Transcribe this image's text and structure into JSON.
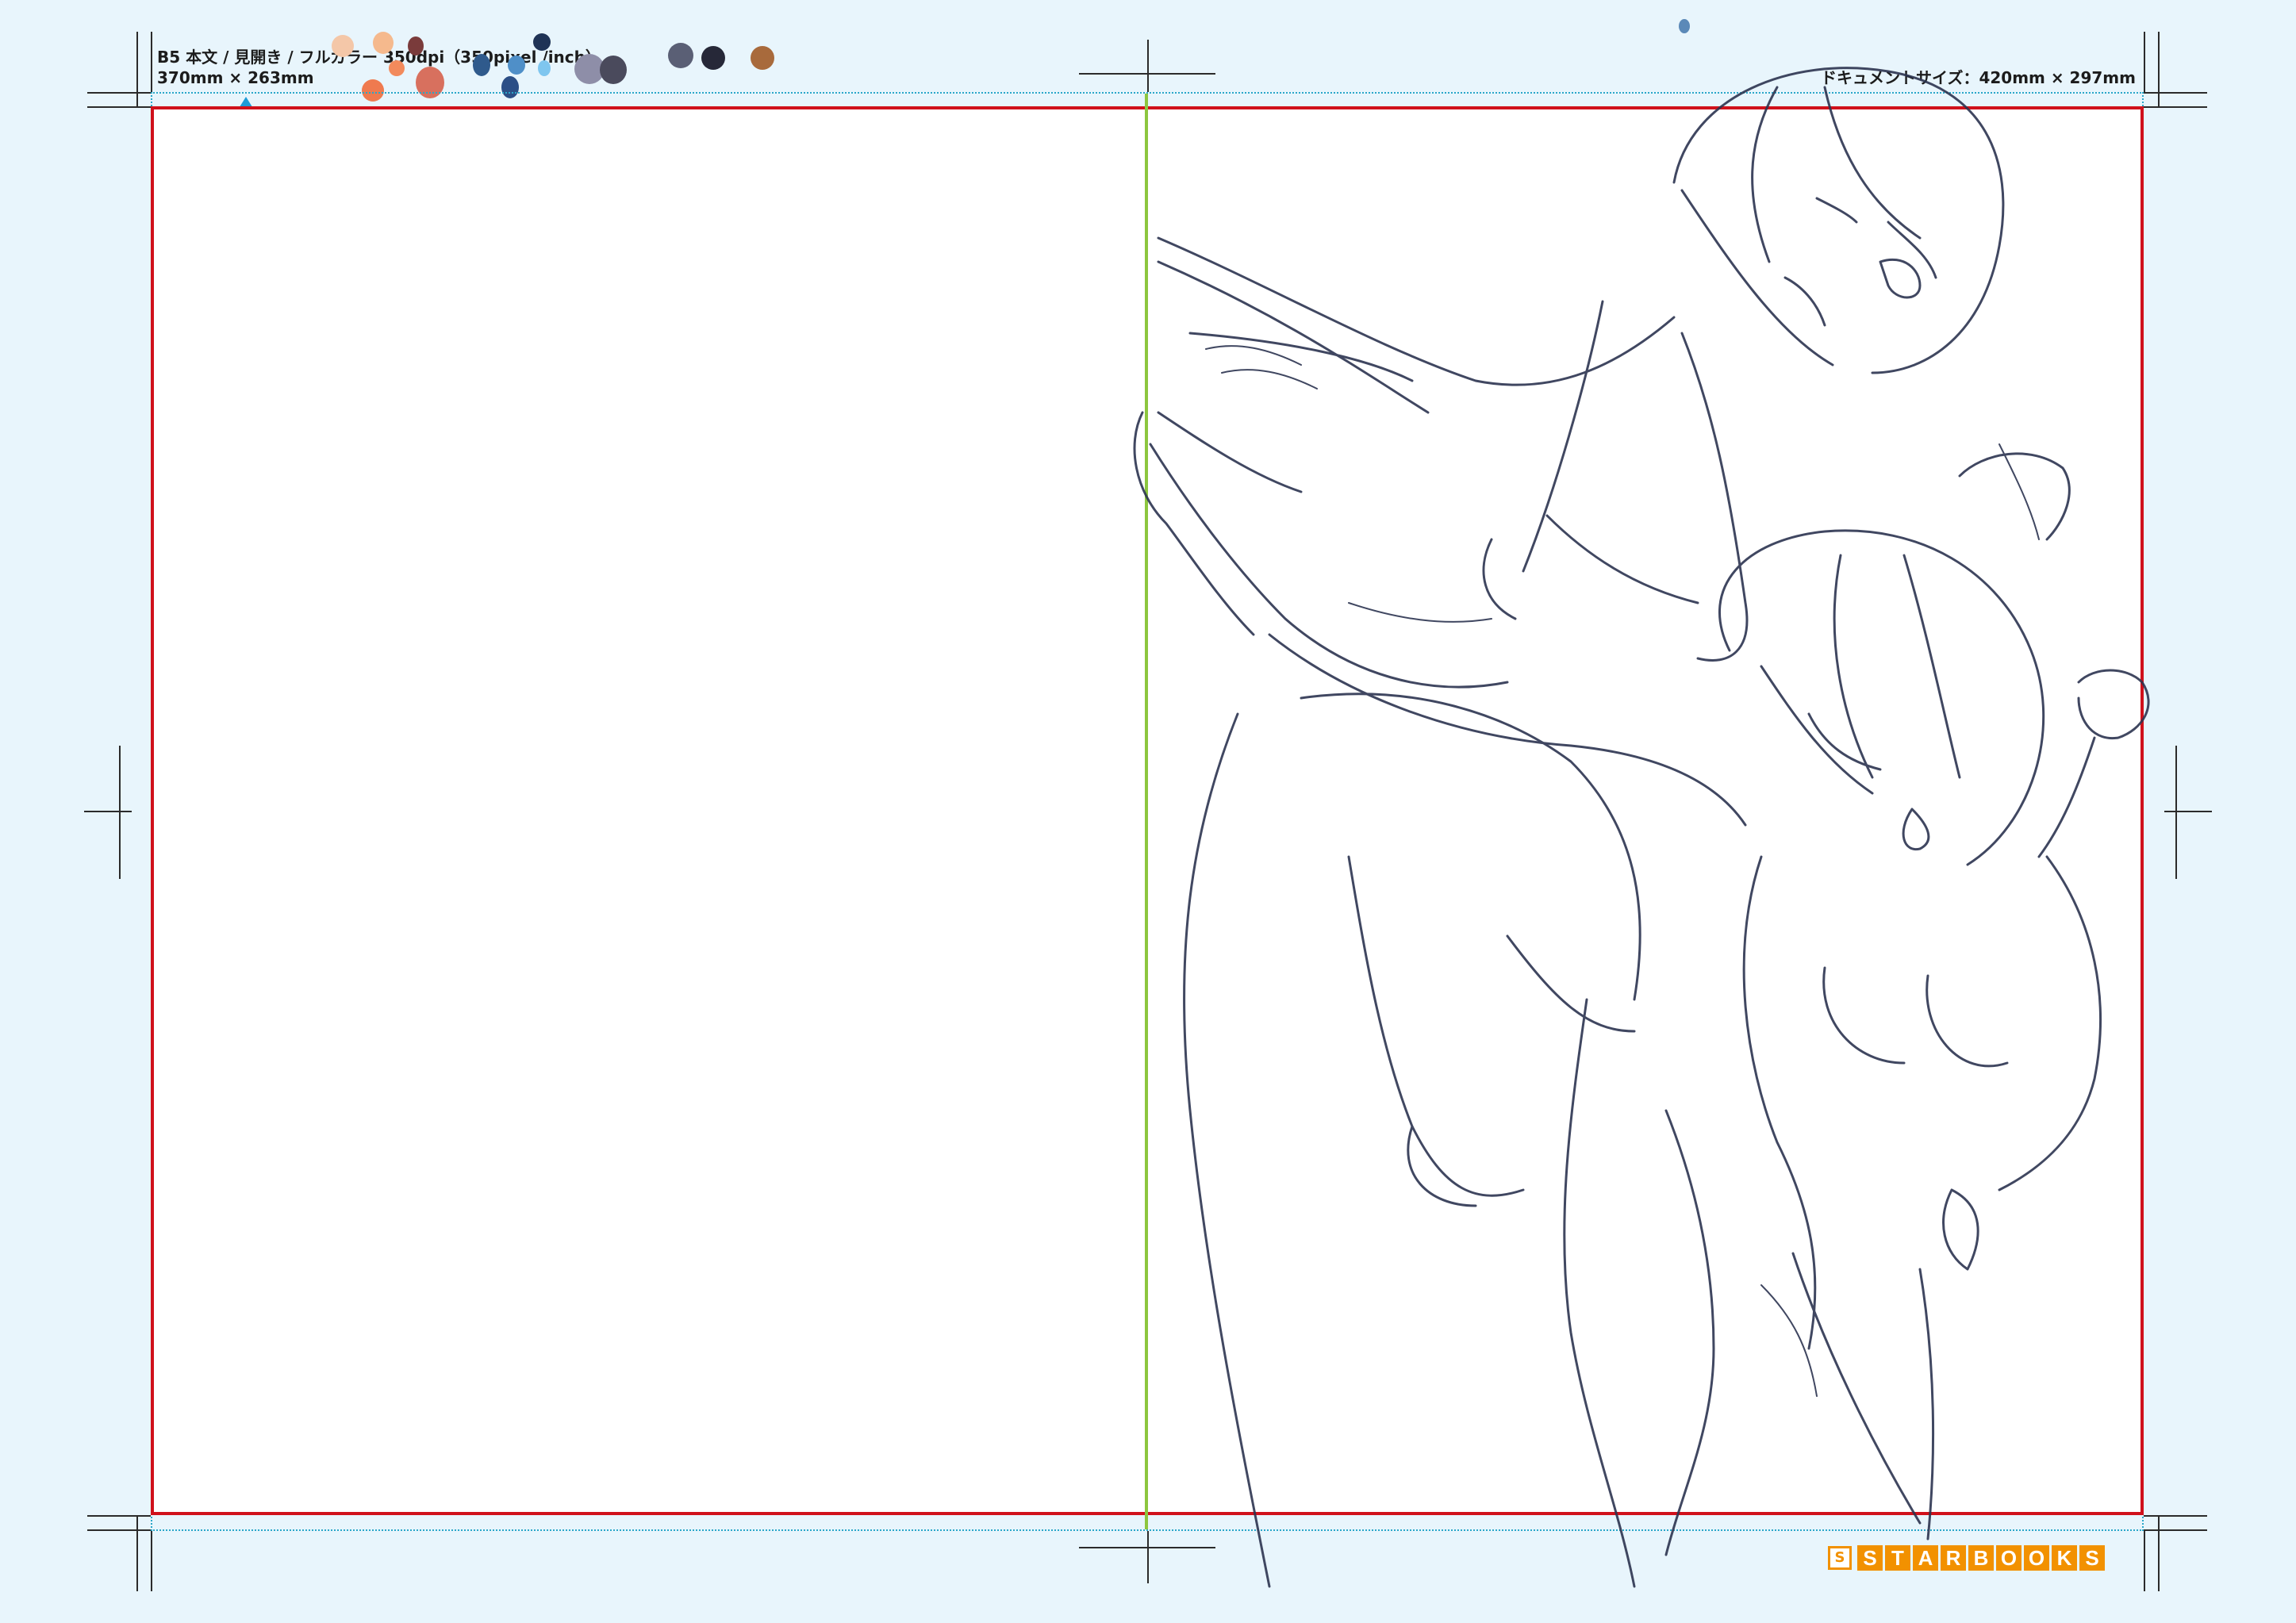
{
  "header": {
    "spec_line": "B5 本文 / 見開き / フルカラー 350dpi（350pixel /inch）",
    "size_line": "370mm × 263mm",
    "doc_size": "ドキュメントサイズ：420mm × 297mm"
  },
  "palette": [
    "#f4c7a8",
    "#f5b98d",
    "#7a3b3b",
    "#f28a5c",
    "#ef7a4f",
    "#d8705e",
    "#2f5a8c",
    "#4f8fc8",
    "#2c4f86",
    "#7fc6ef",
    "#1f3356",
    "#8e8ea8",
    "#4a4a5c",
    "#5a5f75",
    "#262838",
    "#a86a3c",
    "#5b89b8"
  ],
  "logo": {
    "mark": "S",
    "letters": [
      "S",
      "T",
      "A",
      "R",
      "B",
      "O",
      "O",
      "K",
      "S"
    ]
  },
  "colors": {
    "background": "#e8f5fc",
    "trim": "#d0111b",
    "bleed": "#2aa7c9",
    "center_fold": "#8cc63f",
    "logo": "#f29100"
  }
}
